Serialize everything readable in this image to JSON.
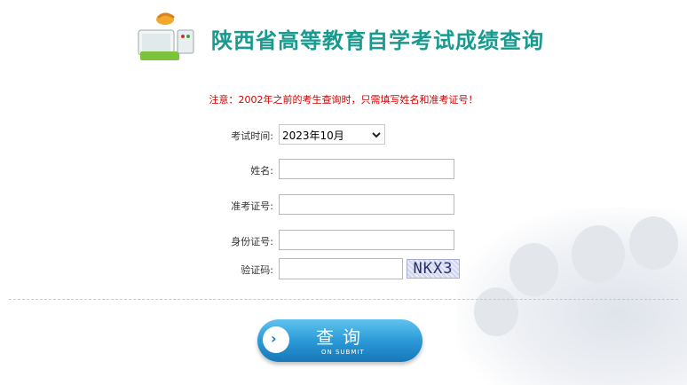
{
  "header": {
    "title": "陕西省高等教育自学考试成绩查询",
    "logo_icon": "computer-with-key-icon"
  },
  "notice": "注意：2002年之前的考生查询时，只需填写姓名和准考证号！",
  "form": {
    "exam_time_label": "考试时间:",
    "exam_time_value": "2023年10月",
    "name_label": "姓名:",
    "ticket_label": "准考证号:",
    "id_label": "身份证号:",
    "captcha_label": "验证码:",
    "captcha_text": "NKX3"
  },
  "submit": {
    "label": "查询",
    "sublabel": "ON SUBMIT",
    "icon": "chevron-right-icon"
  },
  "colors": {
    "title": "#199a8f",
    "notice": "#d40000",
    "button": "#2c9ad8"
  }
}
